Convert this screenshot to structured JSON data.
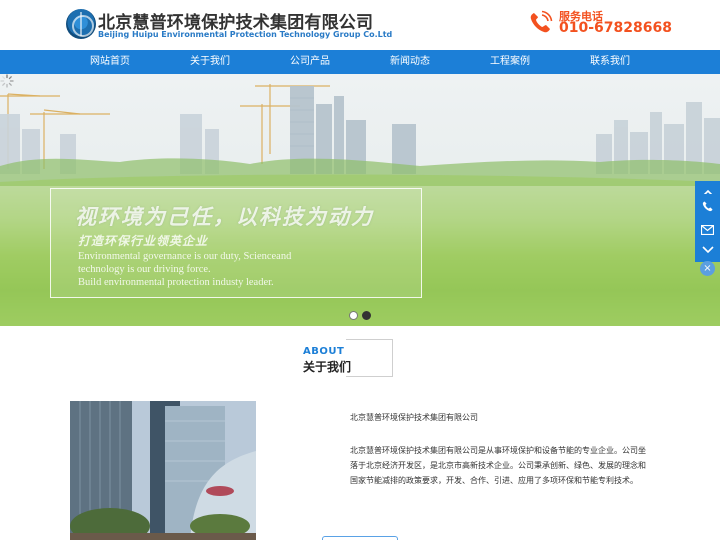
{
  "header": {
    "company_cn": "北京慧普环境保护技术集团有限公司",
    "company_en": "Beijing Huipu Environmental Protection Technology Group Co.Ltd",
    "service_label": "服务电话",
    "service_number": "010-67828668"
  },
  "nav": {
    "items": [
      {
        "label": "网站首页"
      },
      {
        "label": "关于我们"
      },
      {
        "label": "公司产品"
      },
      {
        "label": "新闻动态"
      },
      {
        "label": "工程案例"
      },
      {
        "label": "联系我们"
      }
    ]
  },
  "banner": {
    "slogan_cn": "视环境为己任，以科技为动力",
    "slogan_sub": "打造环保行业领英企业",
    "slogan_en_1": "Environmental governance is our duty, Scienceand",
    "slogan_en_2": "technology is our driving force.",
    "slogan_en_3": "Build environmental protection industy leader.",
    "slide_count": 2,
    "active_slide": 2
  },
  "sidebar": {
    "icons": [
      "chevron-up-icon",
      "phone-icon",
      "mail-icon",
      "chevron-down-icon"
    ],
    "close_label": "×"
  },
  "about": {
    "heading_en": "ABOUT",
    "heading_cn": "关于我们",
    "title": "北京慧普环境保护技术集团有限公司",
    "body_1": "北京慧普环境保护技术集团有限公司是从事环境保护和设备节能的专业企业。公司坐",
    "body_2": "落于北京经济开发区，是北京市高新技术企业。公司秉承创新、绿色、发展的理念和",
    "body_3": "国家节能减排的政策要求，开发、合作、引进、应用了多项环保和节能专利技术。"
  },
  "colors": {
    "brand_blue": "#1c7fd7",
    "phone_orange": "#f3511f"
  }
}
